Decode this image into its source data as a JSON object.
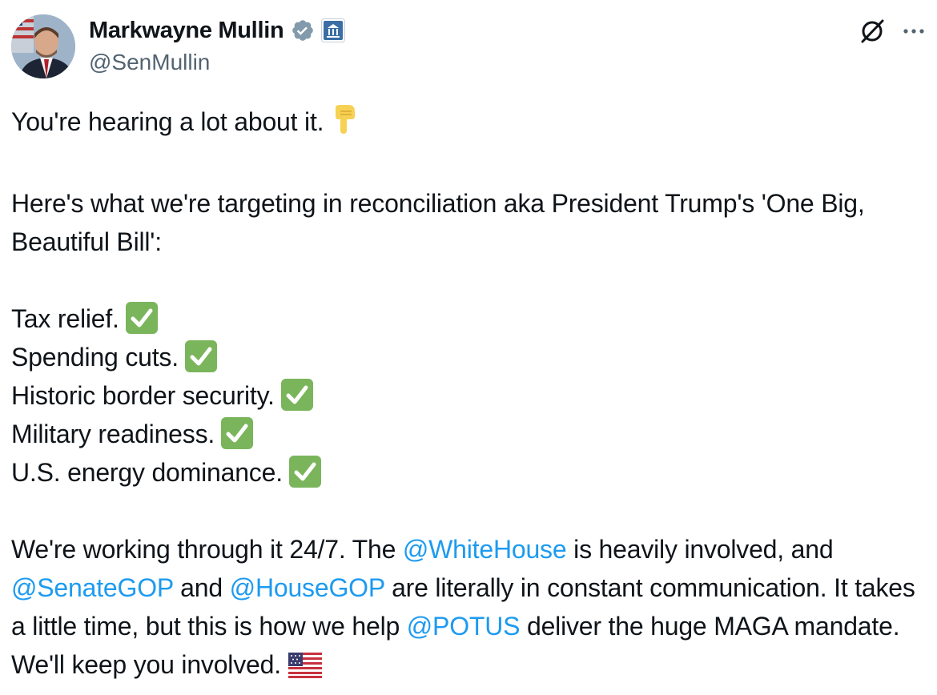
{
  "author": {
    "display_name": "Markwayne Mullin",
    "handle": "@SenMullin",
    "avatar_icon": "avatar-photo",
    "verified_icon": "verified-badge-icon",
    "affiliation_icon": "government-building-icon"
  },
  "header_actions": {
    "grok_icon": "grok-icon",
    "more_icon": "more-options-icon"
  },
  "tweet": {
    "line1": "You're hearing a lot about it.",
    "line1_emoji": "pointing-down-icon",
    "para2": "Here's what we're targeting in reconciliation aka President Trump's 'One Big, Beautiful Bill':",
    "items": [
      "Tax relief.",
      "Spending cuts.",
      "Historic border security.",
      "Military readiness.",
      "U.S. energy dominance."
    ],
    "check_emoji": "check-mark-button-icon",
    "p3_part1": "We're working through it 24/7. The ",
    "mention_whitehouse": "@WhiteHouse",
    "p3_part2": " is heavily involved, and ",
    "mention_senategop": "@SenateGOP",
    "p3_part3": " and ",
    "mention_housegop": "@HouseGOP",
    "p3_part4": " are literally in constant communication. It takes a little time, but this is how we help ",
    "mention_potus": "@POTUS",
    "p3_part5": " deliver the huge MAGA mandate. We'll keep you involved.",
    "flag_emoji": "us-flag-icon"
  },
  "colors": {
    "link": "#1d9bf0",
    "text": "#0f1419",
    "secondary": "#536471",
    "check_bg": "#7ab55c"
  }
}
